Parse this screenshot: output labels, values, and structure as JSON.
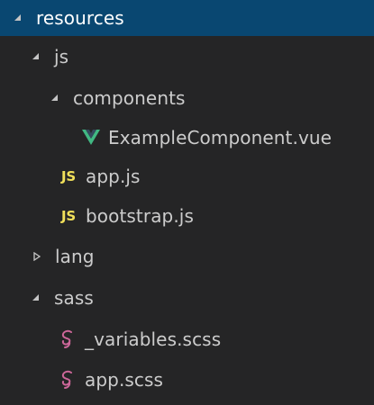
{
  "explorer": {
    "items": [
      {
        "label": "resources",
        "icon": "chevron-down-icon",
        "selected": true
      },
      {
        "label": "js",
        "icon": "chevron-down-icon"
      },
      {
        "label": "components",
        "icon": "chevron-down-icon"
      },
      {
        "label": "ExampleComponent.vue",
        "icon": "vue-file-icon"
      },
      {
        "label": "app.js",
        "icon": "javascript-file-icon",
        "badge": "JS"
      },
      {
        "label": "bootstrap.js",
        "icon": "javascript-file-icon",
        "badge": "JS"
      },
      {
        "label": "lang",
        "icon": "chevron-right-icon"
      },
      {
        "label": "sass",
        "icon": "chevron-down-icon"
      },
      {
        "label": "_variables.scss",
        "icon": "sass-file-icon"
      },
      {
        "label": "app.scss",
        "icon": "sass-file-icon"
      }
    ]
  },
  "colors": {
    "background": "#252526",
    "selected": "#094771",
    "text": "#cccccc",
    "js": "#f1e05a",
    "vue_green": "#41b883",
    "vue_dark": "#35495e",
    "sass_pink": "#cd6799"
  }
}
